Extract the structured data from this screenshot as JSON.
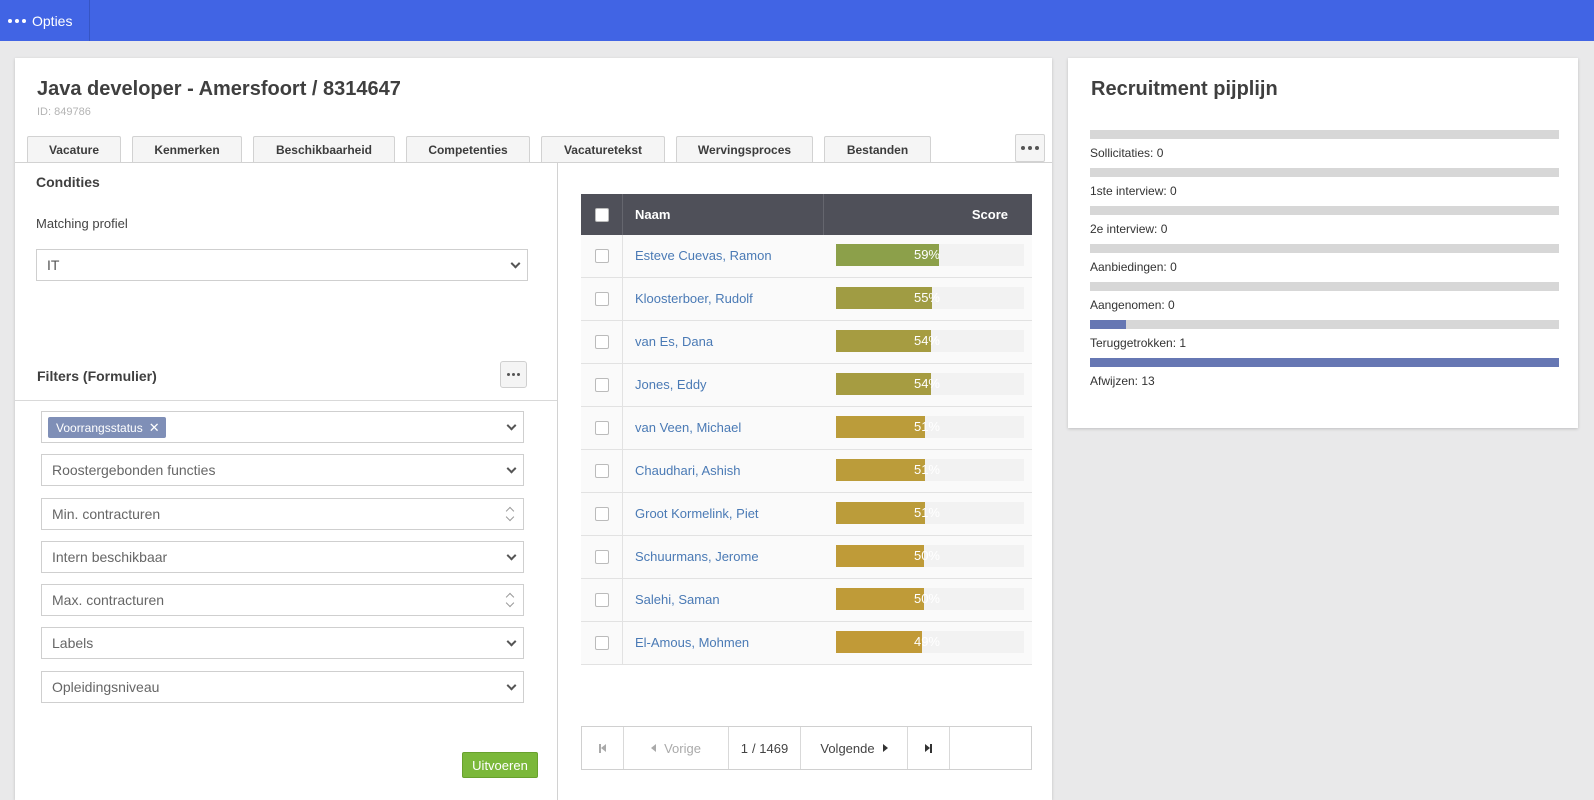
{
  "topbar": {
    "options_label": "Opties"
  },
  "job": {
    "title": "Java developer - Amersfoort / 8314647",
    "id_label": "ID: 849786"
  },
  "tabs": [
    {
      "label": "Vacature"
    },
    {
      "label": "Kenmerken"
    },
    {
      "label": "Beschikbaarheid"
    },
    {
      "label": "Competenties"
    },
    {
      "label": "Vacaturetekst"
    },
    {
      "label": "Wervingsproces"
    },
    {
      "label": "Bestanden"
    }
  ],
  "conditions": {
    "title": "Condities",
    "matching_label": "Matching profiel",
    "matching_value": "IT"
  },
  "filters": {
    "title": "Filters (Formulier)",
    "tag": "Voorrangsstatus",
    "fields": [
      {
        "placeholder": "Roostergebonden functies",
        "kind": "select"
      },
      {
        "placeholder": "Min. contracturen",
        "kind": "number"
      },
      {
        "placeholder": "Intern beschikbaar",
        "kind": "select"
      },
      {
        "placeholder": "Max. contracturen",
        "kind": "number"
      },
      {
        "placeholder": "Labels",
        "kind": "select"
      },
      {
        "placeholder": "Opleidingsniveau",
        "kind": "select"
      }
    ],
    "run_label": "Uitvoeren"
  },
  "table": {
    "col_name": "Naam",
    "col_score": "Score",
    "rows": [
      {
        "name": "Esteve Cuevas, Ramon",
        "score": 59,
        "score_label": "59%",
        "color": "#8ca04a"
      },
      {
        "name": "Kloosterboer, Rudolf",
        "score": 55,
        "score_label": "55%",
        "color": "#a09c43"
      },
      {
        "name": "van Es, Dana",
        "score": 54,
        "score_label": "54%",
        "color": "#a69c41"
      },
      {
        "name": "Jones, Eddy",
        "score": 54,
        "score_label": "54%",
        "color": "#a69c41"
      },
      {
        "name": "van Veen, Michael",
        "score": 51,
        "score_label": "51%",
        "color": "#bb9c3a"
      },
      {
        "name": "Chaudhari, Ashish",
        "score": 51,
        "score_label": "51%",
        "color": "#bb9c3a"
      },
      {
        "name": "Groot Kormelink, Piet",
        "score": 51,
        "score_label": "51%",
        "color": "#bb9c3a"
      },
      {
        "name": "Schuurmans, Jerome",
        "score": 50,
        "score_label": "50%",
        "color": "#bf9b38"
      },
      {
        "name": "Salehi, Saman",
        "score": 50,
        "score_label": "50%",
        "color": "#bf9b38"
      },
      {
        "name": "El-Amous, Mohmen",
        "score": 49,
        "score_label": "49%",
        "color": "#c19a37"
      }
    ]
  },
  "pager": {
    "prev_label": "Vorige",
    "next_label": "Volgende",
    "current_page": "1",
    "total_pages": "/ 1469"
  },
  "pipeline": {
    "title": "Recruitment pijplijn",
    "max": 13,
    "items": [
      {
        "label": "Sollicitaties: 0",
        "value": 0
      },
      {
        "label": "1ste interview: 0",
        "value": 0
      },
      {
        "label": "2e interview: 0",
        "value": 0
      },
      {
        "label": "Aanbiedingen: 0",
        "value": 0
      },
      {
        "label": "Aangenomen: 0",
        "value": 0
      },
      {
        "label": "Teruggetrokken: 1",
        "value": 1
      },
      {
        "label": "Afwijzen: 13",
        "value": 13
      }
    ]
  }
}
